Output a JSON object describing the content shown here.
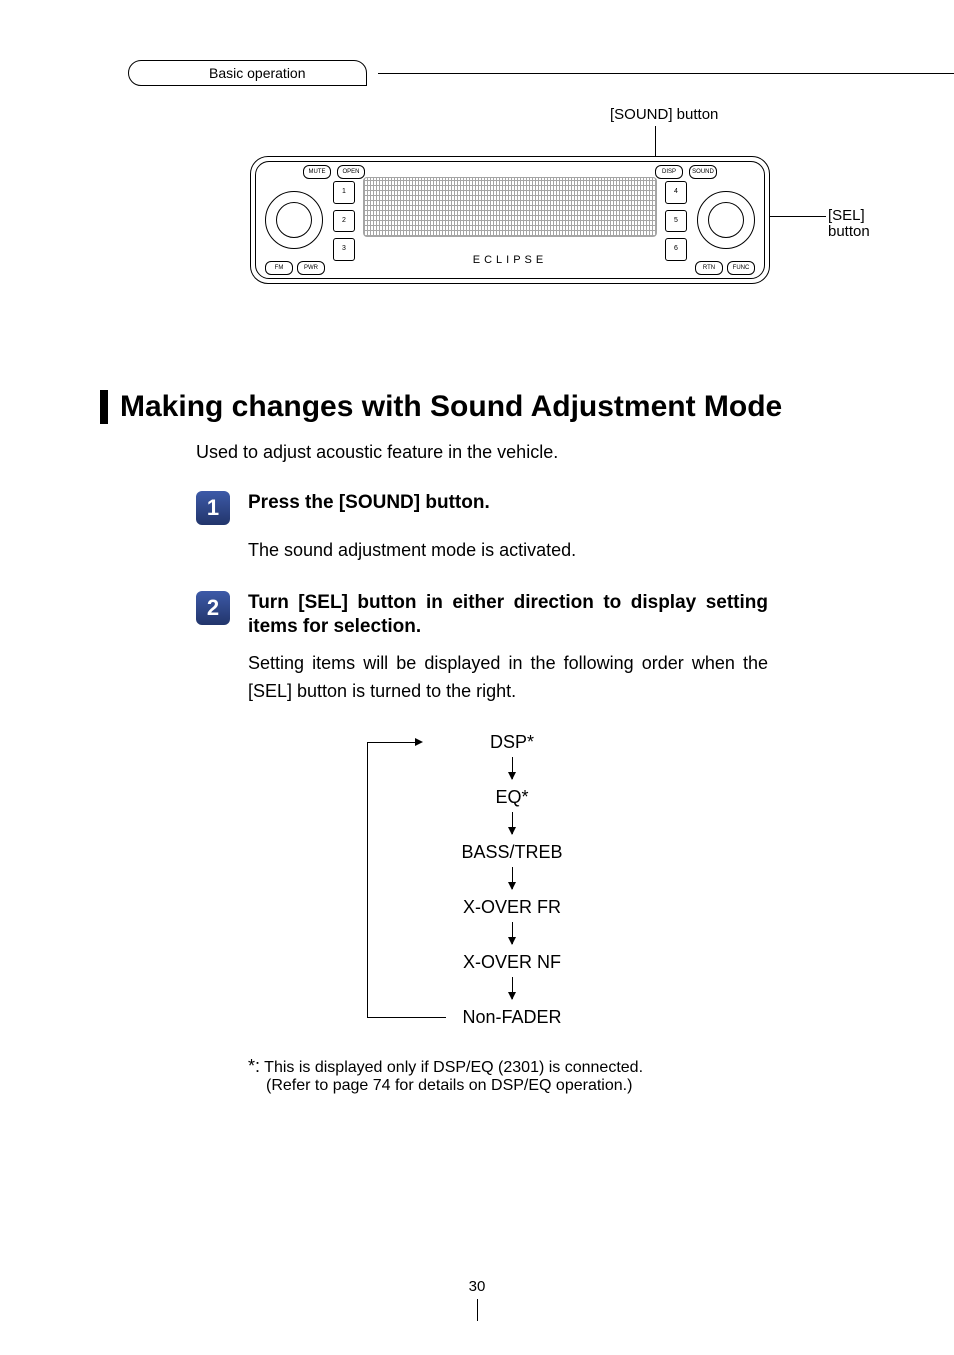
{
  "breadcrumb": "Basic operation",
  "figure": {
    "callout_top": "[SOUND] button",
    "callout_right_l1": "[SEL]",
    "callout_right_l2": "button",
    "brand": "ECLIPSE",
    "left_preset_labels": [
      "1",
      "2",
      "3"
    ],
    "right_preset_labels": [
      "4",
      "5",
      "6"
    ]
  },
  "heading": "Making changes with Sound Adjustment Mode",
  "lead": "Used to adjust acoustic feature in the vehicle.",
  "steps": [
    {
      "num": "1",
      "title": "Press the [SOUND] button.",
      "body": "The sound adjustment mode is activated."
    },
    {
      "num": "2",
      "title": "Turn [SEL] button in either direction to display setting items for selection.",
      "body": "Setting items will be displayed in the following order when the [SEL] button is turned to the right."
    }
  ],
  "flow": [
    "DSP*",
    "EQ*",
    "BASS/TREB",
    "X-OVER FR",
    "X-OVER NF",
    "Non-FADER"
  ],
  "footnote": {
    "marker": "*:",
    "line1": "This is displayed only if DSP/EQ (2301) is  connected.",
    "line2": "(Refer to page 74 for details on DSP/EQ operation.)"
  },
  "page_number": "30"
}
